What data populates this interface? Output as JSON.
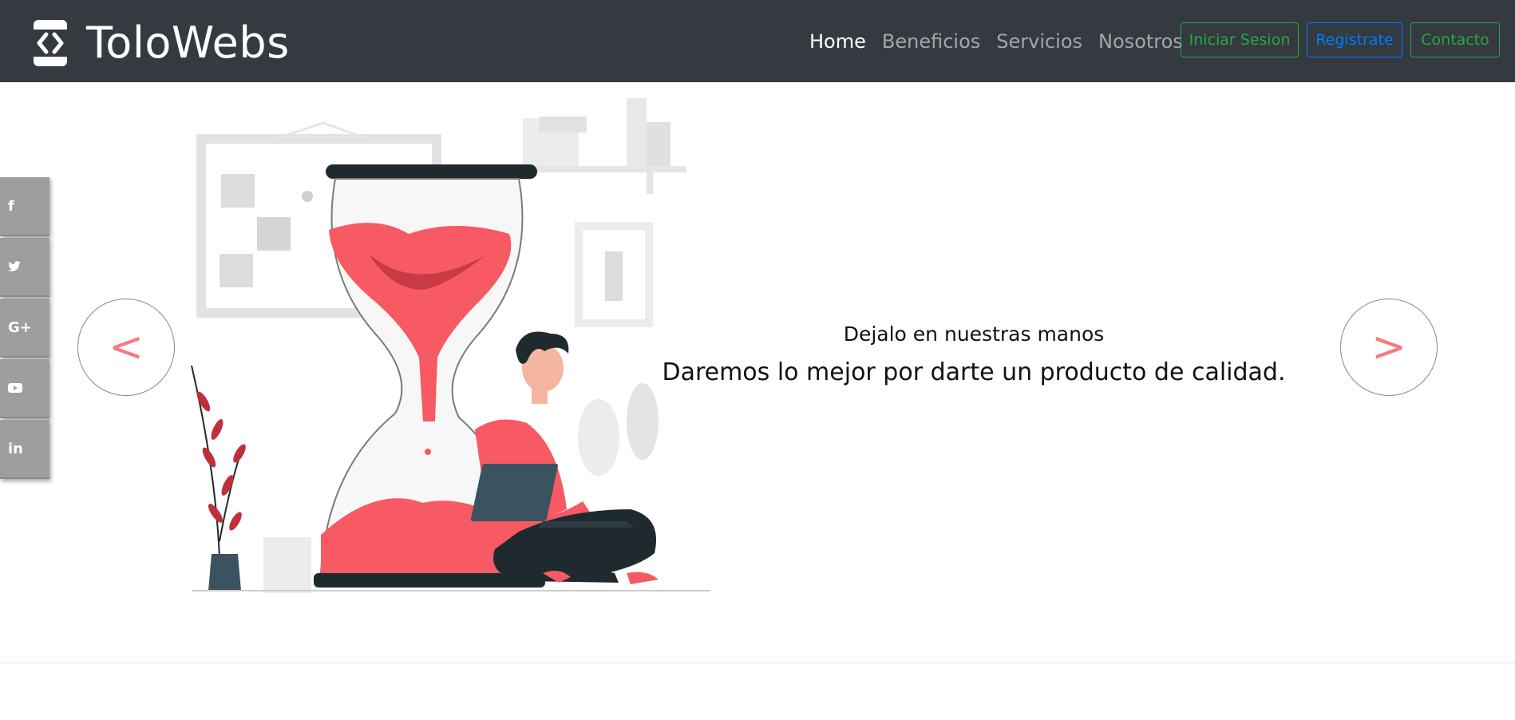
{
  "brand": {
    "name": "ToloWebs",
    "icon": "code-brackets-icon"
  },
  "nav": {
    "links": [
      {
        "label": "Home",
        "active": true
      },
      {
        "label": "Beneficios",
        "active": false
      },
      {
        "label": "Servicios",
        "active": false
      },
      {
        "label": "Nosotros",
        "active": false
      }
    ],
    "login_label": "Iniciar Sesion",
    "register_label": "Registrate",
    "contact_label": "Contacto"
  },
  "social": [
    {
      "icon": "facebook-icon",
      "glyph": "f"
    },
    {
      "icon": "twitter-icon",
      "glyph": "t"
    },
    {
      "icon": "google-plus-icon",
      "glyph": "G+"
    },
    {
      "icon": "youtube-icon",
      "glyph": "▶"
    },
    {
      "icon": "linkedin-icon",
      "glyph": "in"
    }
  ],
  "carousel": {
    "prev_label": "<",
    "next_label": ">",
    "subtitle": "Dejalo en nuestras manos",
    "title": "Daremos lo mejor por darte un producto de calidad."
  },
  "colors": {
    "navbar": "#343a40",
    "accent_red": "#f75a63",
    "green": "#28a745",
    "blue": "#007bff"
  }
}
